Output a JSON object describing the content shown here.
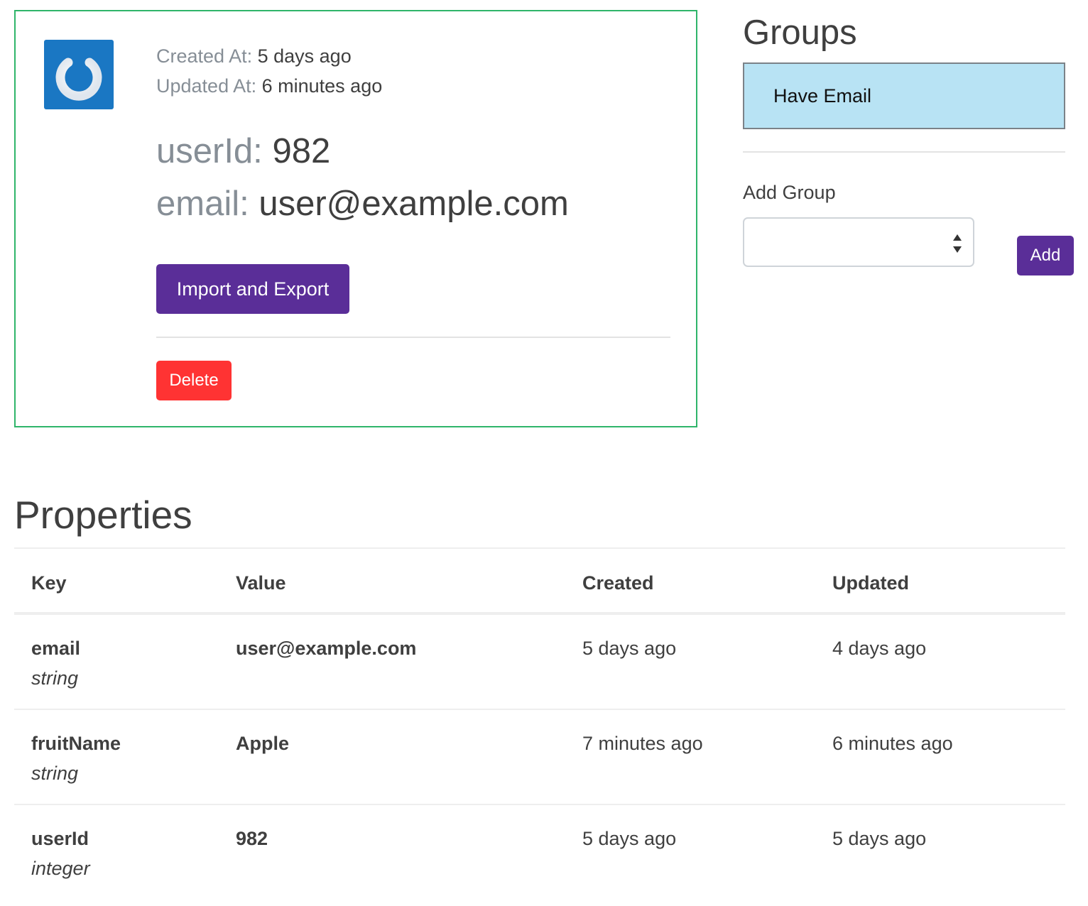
{
  "profile": {
    "avatar_icon": "power-icon",
    "avatar_color": "#1a77c3",
    "created_label": "Created At:",
    "created_value": "5 days ago",
    "updated_label": "Updated At:",
    "updated_value": "6 minutes ago",
    "userid_label": "userId:",
    "userid_value": "982",
    "email_label": "email:",
    "email_value": "user@example.com",
    "import_export_label": "Import and Export",
    "delete_label": "Delete"
  },
  "groups": {
    "title": "Groups",
    "items": [
      {
        "label": "Have Email"
      }
    ],
    "add_group_label": "Add Group",
    "select_value": "",
    "add_button_label": "Add"
  },
  "properties": {
    "title": "Properties",
    "columns": [
      "Key",
      "Value",
      "Created",
      "Updated"
    ],
    "rows": [
      {
        "key": "email",
        "type": "string",
        "value": "user@example.com",
        "created": "5 days ago",
        "updated": "4 days ago"
      },
      {
        "key": "fruitName",
        "type": "string",
        "value": "Apple",
        "created": "7 minutes ago",
        "updated": "6 minutes ago"
      },
      {
        "key": "userId",
        "type": "integer",
        "value": "982",
        "created": "5 days ago",
        "updated": "5 days ago"
      }
    ]
  },
  "colors": {
    "primary": "#5a2e98",
    "danger": "#ff3333",
    "card_border": "#2fb56a",
    "group_highlight": "#b8e3f4"
  }
}
